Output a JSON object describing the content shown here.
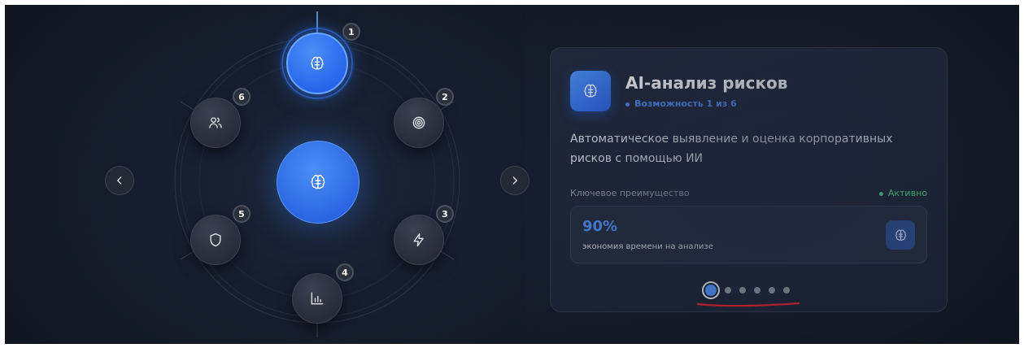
{
  "colors": {
    "accent": "#3b82f6",
    "active_green": "#4ade80",
    "annotation_red": "#e11d2a"
  },
  "carousel": {
    "prev_icon": "chevron-left-icon",
    "next_icon": "chevron-right-icon",
    "features": [
      {
        "number": "1",
        "icon": "brain-icon",
        "active": true
      },
      {
        "number": "2",
        "icon": "target-icon"
      },
      {
        "number": "3",
        "icon": "lightning-icon"
      },
      {
        "number": "4",
        "icon": "bar-chart-icon"
      },
      {
        "number": "5",
        "icon": "shield-icon"
      },
      {
        "number": "6",
        "icon": "users-icon"
      }
    ],
    "center_icon": "brain-icon"
  },
  "card": {
    "icon": "brain-icon",
    "title": "AI-анализ рисков",
    "subtitle": "Возможность 1 из 6",
    "description": "Автоматическое выявление и оценка корпоративных рисков с помощью ИИ",
    "key_benefit_label": "Ключевое преимущество",
    "status": "Активно",
    "metric_value": "90%",
    "metric_caption": "экономия времени на анализе",
    "metric_icon": "brain-icon"
  },
  "pagination": {
    "total": 6,
    "active": 1
  }
}
